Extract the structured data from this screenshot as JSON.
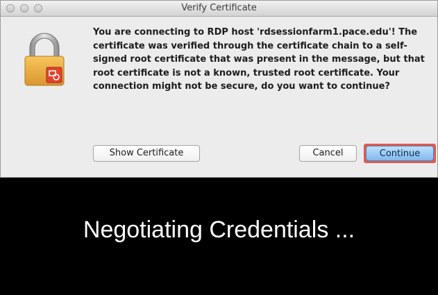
{
  "window": {
    "title": "Verify Certificate",
    "traffic_lights": [
      "close",
      "minimize",
      "zoom"
    ]
  },
  "dialog": {
    "icon": "lock-certificate-icon",
    "message_lines": [
      "You are connecting to RDP host 'rdsessionfarm1.pace.edu'! The",
      "certificate was verified through the certificate chain to a self-",
      "signed root certificate that was present in the message, but that",
      "root certificate is not a known, trusted root certificate. Your",
      "connection might not be secure, do you want to continue?"
    ],
    "buttons": {
      "show_certificate": "Show Certificate",
      "cancel": "Cancel",
      "continue": "Continue"
    },
    "highlight_color": "#e25b4a"
  },
  "background_screen": {
    "status_text": "Negotiating Credentials ..."
  }
}
